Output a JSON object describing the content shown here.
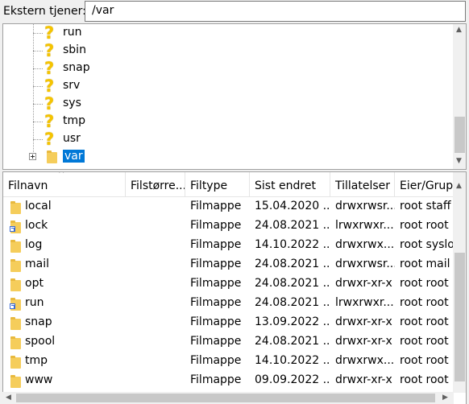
{
  "path_bar": {
    "label": "Ekstern tjener:",
    "value": "/var"
  },
  "tree": {
    "items": [
      {
        "name": "run",
        "icon": "unknown-question-icon"
      },
      {
        "name": "sbin",
        "icon": "unknown-question-icon"
      },
      {
        "name": "snap",
        "icon": "unknown-question-icon"
      },
      {
        "name": "srv",
        "icon": "unknown-question-icon"
      },
      {
        "name": "sys",
        "icon": "unknown-question-icon"
      },
      {
        "name": "tmp",
        "icon": "unknown-question-icon"
      },
      {
        "name": "usr",
        "icon": "unknown-question-icon"
      },
      {
        "name": "var",
        "icon": "folder-icon",
        "selected": true
      }
    ]
  },
  "file_list": {
    "columns": [
      "Filnavn",
      "Filstørre...",
      "Filtype",
      "Sist endret",
      "Tillatelser",
      "Eier/Grup..."
    ],
    "rows": [
      {
        "name": "local",
        "size": "",
        "type": "Filmappe",
        "modified": "15.04.2020 ...",
        "perms": "drwxrwsr...",
        "owner": "root staff",
        "symlink": false
      },
      {
        "name": "lock",
        "size": "",
        "type": "Filmappe",
        "modified": "24.08.2021 ...",
        "perms": "lrwxrwxr...",
        "owner": "root root",
        "symlink": true
      },
      {
        "name": "log",
        "size": "",
        "type": "Filmappe",
        "modified": "14.10.2022 ...",
        "perms": "drwxrwx...",
        "owner": "root syslog",
        "symlink": false
      },
      {
        "name": "mail",
        "size": "",
        "type": "Filmappe",
        "modified": "24.08.2021 ...",
        "perms": "drwxrwsr...",
        "owner": "root mail",
        "symlink": false
      },
      {
        "name": "opt",
        "size": "",
        "type": "Filmappe",
        "modified": "24.08.2021 ...",
        "perms": "drwxr-xr-x",
        "owner": "root root",
        "symlink": false
      },
      {
        "name": "run",
        "size": "",
        "type": "Filmappe",
        "modified": "24.08.2021 ...",
        "perms": "lrwxrwxr...",
        "owner": "root root",
        "symlink": true
      },
      {
        "name": "snap",
        "size": "",
        "type": "Filmappe",
        "modified": "13.09.2022 ...",
        "perms": "drwxr-xr-x",
        "owner": "root root",
        "symlink": false
      },
      {
        "name": "spool",
        "size": "",
        "type": "Filmappe",
        "modified": "24.08.2021 ...",
        "perms": "drwxr-xr-x",
        "owner": "root root",
        "symlink": false
      },
      {
        "name": "tmp",
        "size": "",
        "type": "Filmappe",
        "modified": "14.10.2022 ...",
        "perms": "drwxrwx...",
        "owner": "root root",
        "symlink": false
      },
      {
        "name": "www",
        "size": "",
        "type": "Filmappe",
        "modified": "09.09.2022 ...",
        "perms": "drwxr-xr-x",
        "owner": "root root",
        "symlink": false
      }
    ]
  },
  "colors": {
    "selection": "#0078d7",
    "folder": "#f5cd5b",
    "question": "#f5c400"
  }
}
